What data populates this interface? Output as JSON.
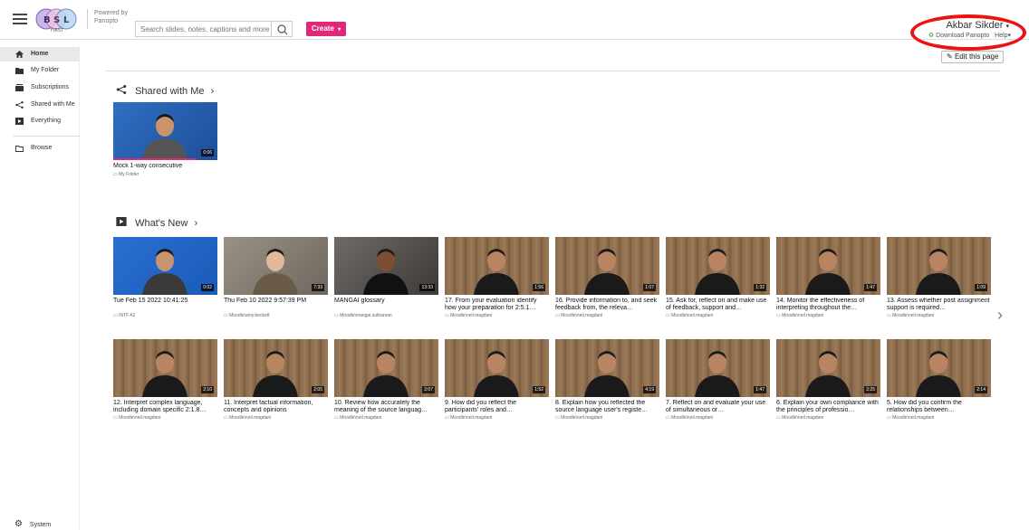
{
  "header": {
    "powered_line1": "Powered by",
    "powered_line2": "Panopto",
    "logo_text": "BSL FIRST",
    "search_placeholder": "Search slides, notes, captions and more",
    "create_label": "Create",
    "create_caret": "▾",
    "user_name": "Akbar Sikder",
    "user_caret": "▾",
    "download_label": "Download Panopto",
    "help_label": "Help",
    "help_caret": "▾"
  },
  "colors": {
    "accent": "#e0287a",
    "highlight_ring": "#ee1111",
    "download_icon": "#4a9d3a"
  },
  "sidebar": {
    "items": [
      {
        "label": "Home",
        "icon": "home-icon",
        "active": true
      },
      {
        "label": "My Folder",
        "icon": "folder-icon"
      },
      {
        "label": "Subscriptions",
        "icon": "subscriptions-icon"
      },
      {
        "label": "Shared with Me",
        "icon": "share-icon"
      },
      {
        "label": "Everything",
        "icon": "everything-icon"
      },
      {
        "label": "Browse",
        "icon": "browse-folder-icon"
      }
    ],
    "system_label": "System"
  },
  "main": {
    "edit_label": "Edit this page",
    "shared": {
      "title": "Shared with Me",
      "chevron": "›",
      "items": [
        {
          "title": "Mock 1-way consecutive",
          "folder": "My Folder",
          "duration": "0:06"
        }
      ]
    },
    "whats_new": {
      "title": "What's New",
      "chevron": "›",
      "row1": [
        {
          "title": "Tue Feb 15 2022 10:41:25",
          "folder": "INTF A2",
          "duration": "0:02"
        },
        {
          "title": "Thu Feb 10 2022 9:57:39 PM",
          "folder": "Moodle\\amy.beckett",
          "duration": "7:33"
        },
        {
          "title": "MANGAI glossary",
          "folder": "Moodle\\mangai.sutharsan",
          "duration": "13:33"
        },
        {
          "title": "17. From your evaluation identify how your preparation for 2:5.1…",
          "folder": "Moodle\\neil.magdani",
          "duration": "1:56"
        },
        {
          "title": "16. Provide information to, and seek feedback from, the releva…",
          "folder": "Moodle\\neil.magdani",
          "duration": "1:07"
        },
        {
          "title": "15. Ask for, reflect on and make use of feedback, support and…",
          "folder": "Moodle\\neil.magdani",
          "duration": "1:32"
        },
        {
          "title": "14. Monitor the effectiveness of interpreting throughout the…",
          "folder": "Moodle\\neil.magdani",
          "duration": "1:47"
        },
        {
          "title": "13. Assess whether post assignment support is required…",
          "folder": "Moodle\\neil.magdani",
          "duration": "1:09"
        }
      ],
      "row2": [
        {
          "title": "12. Interpret complex language, including domain specific 2:1.8…",
          "folder": "Moodle\\neil.magdani",
          "duration": "2:10"
        },
        {
          "title": "11. Interpret factual information, concepts and opinions",
          "folder": "Moodle\\neil.magdani",
          "duration": "2:05"
        },
        {
          "title": "10. Review how accurately the meaning of the source languag…",
          "folder": "Moodle\\neil.magdani",
          "duration": "2:07"
        },
        {
          "title": "9. How did you reflect the participants' roles and…",
          "folder": "Moodle\\neil.magdani",
          "duration": "1:52"
        },
        {
          "title": "8. Explain how you reflected the source language user's registe…",
          "folder": "Moodle\\neil.magdani",
          "duration": "4:19"
        },
        {
          "title": "7. Reflect on and evaluate your use of simultaneous or…",
          "folder": "Moodle\\neil.magdani",
          "duration": "1:47"
        },
        {
          "title": "6. Explain your own compliance with the principles of professio…",
          "folder": "Moodle\\neil.magdani",
          "duration": "2:25"
        },
        {
          "title": "5. How did you confirm the relationships between…",
          "folder": "Moodle\\neil.magdani",
          "duration": "2:14"
        }
      ],
      "next_arrow": "›"
    }
  }
}
